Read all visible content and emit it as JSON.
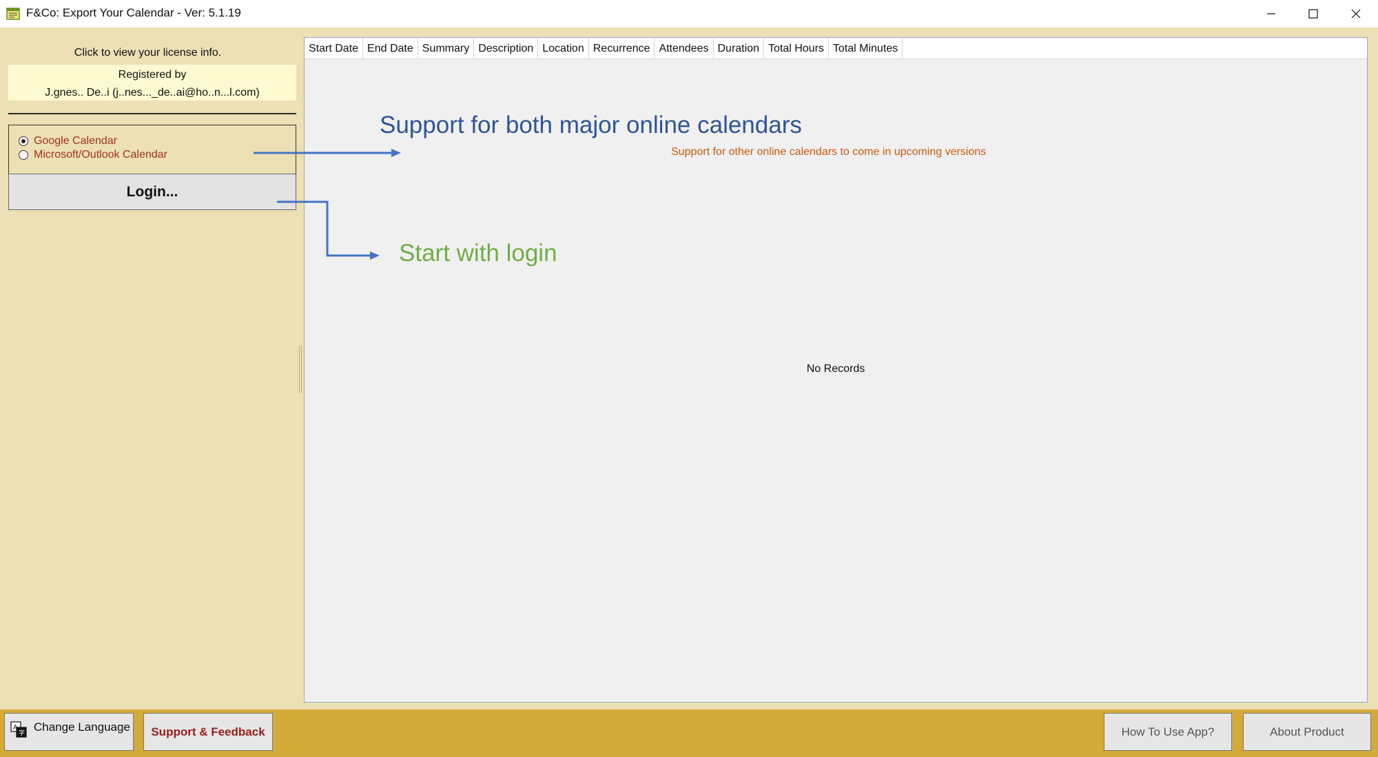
{
  "window": {
    "title": "F&Co: Export Your Calendar - Ver: 5.1.19"
  },
  "license": {
    "link_text": "Click to view your license info.",
    "registered_label": "Registered by",
    "registered_name": "J.gnes.. De..i (j..nes..._de..ai@ho..n...l.com)"
  },
  "calendar_options": [
    {
      "label": "Google Calendar",
      "selected": true
    },
    {
      "label": "Microsoft/Outlook Calendar",
      "selected": false
    }
  ],
  "login_label": "Login...",
  "grid": {
    "columns": [
      "Start Date",
      "End Date",
      "Summary",
      "Description",
      "Location",
      "Recurrence",
      "Attendees",
      "Duration",
      "Total Hours",
      "Total Minutes"
    ],
    "empty_text": "No Records"
  },
  "annotations": {
    "title": "Support for both major online calendars",
    "subtitle": "Support for other online calendars to come in upcoming versions",
    "login_hint": "Start with login",
    "colors": {
      "title": "#2f5597",
      "subtitle": "#c55a11",
      "login_hint": "#70ad47",
      "arrow": "#4472c4"
    }
  },
  "footer": {
    "change_language": "Change Language",
    "support": "Support & Feedback",
    "how_to_use": "How To Use App?",
    "about": "About Product"
  },
  "icons": {
    "app": "calendar-app-icon",
    "language": "translate-icon",
    "minimize": "minimize-icon",
    "maximize": "maximize-icon",
    "close": "close-icon"
  }
}
